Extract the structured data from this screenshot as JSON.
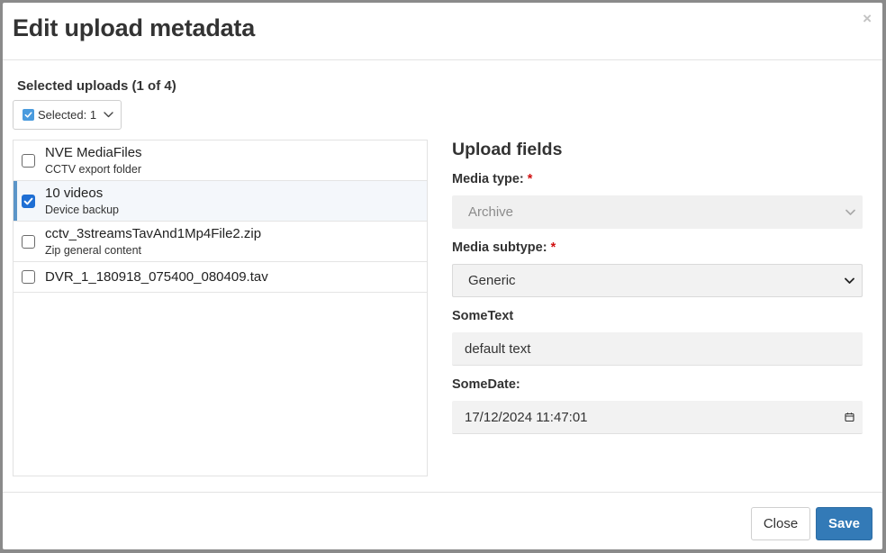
{
  "dialog": {
    "title": "Edit upload metadata",
    "close_glyph": "×"
  },
  "selection": {
    "title": "Selected uploads (1 of 4)",
    "dropdown_label": "Selected: 1"
  },
  "uploads": [
    {
      "name": "NVE MediaFiles",
      "description": "CCTV export folder",
      "checked": false
    },
    {
      "name": "10 videos",
      "description": "Device backup",
      "checked": true
    },
    {
      "name": "cctv_3streamsTavAnd1Mp4File2.zip",
      "description": "Zip general content",
      "checked": false
    },
    {
      "name": "DVR_1_180918_075400_080409.tav",
      "description": "",
      "checked": false
    }
  ],
  "fields": {
    "title": "Upload fields",
    "media_type": {
      "label": "Media type:",
      "required_mark": "*",
      "value": "Archive",
      "disabled": true
    },
    "media_subtype": {
      "label": "Media subtype:",
      "required_mark": "*",
      "value": "Generic"
    },
    "some_text": {
      "label": "SomeText",
      "value": "default text"
    },
    "some_date": {
      "label": "SomeDate:",
      "value": "17/12/2024 11:47:01"
    }
  },
  "footer": {
    "close_label": "Close",
    "save_label": "Save"
  },
  "colors": {
    "primary": "#337ab7",
    "checkbox_checked": "#1f6fd4",
    "active_accent": "#5b95c8",
    "required": "#d01010"
  },
  "icons": {
    "dialog_close": "close-icon",
    "dropdown": "chevron-down-icon",
    "date": "calendar-icon"
  }
}
